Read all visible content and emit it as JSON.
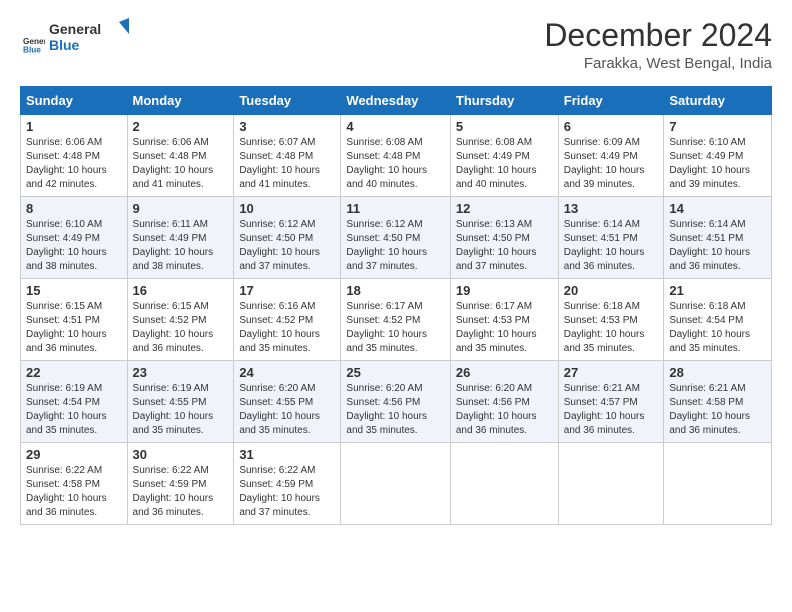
{
  "logo": {
    "line1": "General",
    "line2": "Blue"
  },
  "title": "December 2024",
  "subtitle": "Farakka, West Bengal, India",
  "days_header": [
    "Sunday",
    "Monday",
    "Tuesday",
    "Wednesday",
    "Thursday",
    "Friday",
    "Saturday"
  ],
  "weeks": [
    [
      {
        "day": "1",
        "sunrise": "6:06 AM",
        "sunset": "4:48 PM",
        "daylight": "10 hours and 42 minutes."
      },
      {
        "day": "2",
        "sunrise": "6:06 AM",
        "sunset": "4:48 PM",
        "daylight": "10 hours and 41 minutes."
      },
      {
        "day": "3",
        "sunrise": "6:07 AM",
        "sunset": "4:48 PM",
        "daylight": "10 hours and 41 minutes."
      },
      {
        "day": "4",
        "sunrise": "6:08 AM",
        "sunset": "4:48 PM",
        "daylight": "10 hours and 40 minutes."
      },
      {
        "day": "5",
        "sunrise": "6:08 AM",
        "sunset": "4:49 PM",
        "daylight": "10 hours and 40 minutes."
      },
      {
        "day": "6",
        "sunrise": "6:09 AM",
        "sunset": "4:49 PM",
        "daylight": "10 hours and 39 minutes."
      },
      {
        "day": "7",
        "sunrise": "6:10 AM",
        "sunset": "4:49 PM",
        "daylight": "10 hours and 39 minutes."
      }
    ],
    [
      {
        "day": "8",
        "sunrise": "6:10 AM",
        "sunset": "4:49 PM",
        "daylight": "10 hours and 38 minutes."
      },
      {
        "day": "9",
        "sunrise": "6:11 AM",
        "sunset": "4:49 PM",
        "daylight": "10 hours and 38 minutes."
      },
      {
        "day": "10",
        "sunrise": "6:12 AM",
        "sunset": "4:50 PM",
        "daylight": "10 hours and 37 minutes."
      },
      {
        "day": "11",
        "sunrise": "6:12 AM",
        "sunset": "4:50 PM",
        "daylight": "10 hours and 37 minutes."
      },
      {
        "day": "12",
        "sunrise": "6:13 AM",
        "sunset": "4:50 PM",
        "daylight": "10 hours and 37 minutes."
      },
      {
        "day": "13",
        "sunrise": "6:14 AM",
        "sunset": "4:51 PM",
        "daylight": "10 hours and 36 minutes."
      },
      {
        "day": "14",
        "sunrise": "6:14 AM",
        "sunset": "4:51 PM",
        "daylight": "10 hours and 36 minutes."
      }
    ],
    [
      {
        "day": "15",
        "sunrise": "6:15 AM",
        "sunset": "4:51 PM",
        "daylight": "10 hours and 36 minutes."
      },
      {
        "day": "16",
        "sunrise": "6:15 AM",
        "sunset": "4:52 PM",
        "daylight": "10 hours and 36 minutes."
      },
      {
        "day": "17",
        "sunrise": "6:16 AM",
        "sunset": "4:52 PM",
        "daylight": "10 hours and 35 minutes."
      },
      {
        "day": "18",
        "sunrise": "6:17 AM",
        "sunset": "4:52 PM",
        "daylight": "10 hours and 35 minutes."
      },
      {
        "day": "19",
        "sunrise": "6:17 AM",
        "sunset": "4:53 PM",
        "daylight": "10 hours and 35 minutes."
      },
      {
        "day": "20",
        "sunrise": "6:18 AM",
        "sunset": "4:53 PM",
        "daylight": "10 hours and 35 minutes."
      },
      {
        "day": "21",
        "sunrise": "6:18 AM",
        "sunset": "4:54 PM",
        "daylight": "10 hours and 35 minutes."
      }
    ],
    [
      {
        "day": "22",
        "sunrise": "6:19 AM",
        "sunset": "4:54 PM",
        "daylight": "10 hours and 35 minutes."
      },
      {
        "day": "23",
        "sunrise": "6:19 AM",
        "sunset": "4:55 PM",
        "daylight": "10 hours and 35 minutes."
      },
      {
        "day": "24",
        "sunrise": "6:20 AM",
        "sunset": "4:55 PM",
        "daylight": "10 hours and 35 minutes."
      },
      {
        "day": "25",
        "sunrise": "6:20 AM",
        "sunset": "4:56 PM",
        "daylight": "10 hours and 35 minutes."
      },
      {
        "day": "26",
        "sunrise": "6:20 AM",
        "sunset": "4:56 PM",
        "daylight": "10 hours and 36 minutes."
      },
      {
        "day": "27",
        "sunrise": "6:21 AM",
        "sunset": "4:57 PM",
        "daylight": "10 hours and 36 minutes."
      },
      {
        "day": "28",
        "sunrise": "6:21 AM",
        "sunset": "4:58 PM",
        "daylight": "10 hours and 36 minutes."
      }
    ],
    [
      {
        "day": "29",
        "sunrise": "6:22 AM",
        "sunset": "4:58 PM",
        "daylight": "10 hours and 36 minutes."
      },
      {
        "day": "30",
        "sunrise": "6:22 AM",
        "sunset": "4:59 PM",
        "daylight": "10 hours and 36 minutes."
      },
      {
        "day": "31",
        "sunrise": "6:22 AM",
        "sunset": "4:59 PM",
        "daylight": "10 hours and 37 minutes."
      },
      null,
      null,
      null,
      null
    ]
  ],
  "labels": {
    "sunrise": "Sunrise:",
    "sunset": "Sunset:",
    "daylight": "Daylight:"
  }
}
